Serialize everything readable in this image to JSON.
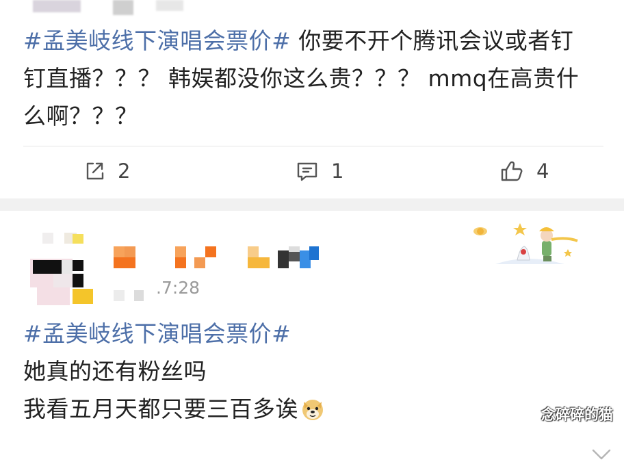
{
  "post1": {
    "hashtag": "#孟美岐线下演唱会票价#",
    "text_line1": " 你要不开个腾讯会议或者钉",
    "text_line2": "钉直播？？？ 韩娱都没你这么贵？？？ mmq在高贵什",
    "text_line3": "么啊？？？",
    "actions": {
      "repost_icon": "share-icon",
      "repost_count": "2",
      "comment_icon": "comment-icon",
      "comment_count": "1",
      "like_icon": "thumbs-up-icon",
      "like_count": "4"
    }
  },
  "post2": {
    "time": ".7:28",
    "hashtag": "#孟美岐线下演唱会票价#",
    "text_line2": "她真的还有粉丝吗",
    "text_line3": "我看五月天都只要三百多诶",
    "emoji": "doge-emoji",
    "card_badge": "little-prince-decoration",
    "menu_icon": "chevron-down-icon"
  },
  "watermark": "念碎碎的猫",
  "colors": {
    "hashtag": "#4d6fa8",
    "separator": "#f1f1f1",
    "meta": "#9a9a9a"
  }
}
